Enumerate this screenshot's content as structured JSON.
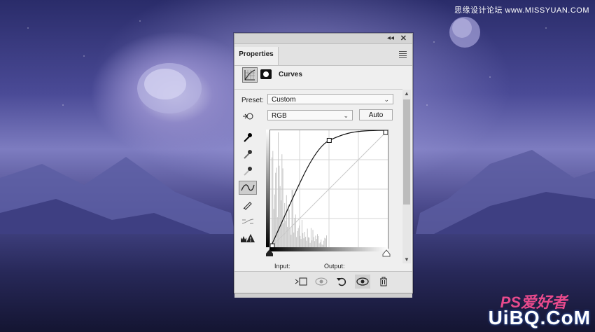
{
  "watermarks": {
    "top": "思缘设计论坛 www.MISSYUAN.COM",
    "ps_mark": "PS爱好者",
    "logo": "UiBQ.CoM"
  },
  "panel": {
    "tab_label": "Properties",
    "adjustment_label": "Curves",
    "preset_label": "Preset:",
    "preset_value": "Custom",
    "channel_value": "RGB",
    "auto_label": "Auto",
    "input_label": "Input:",
    "output_label": "Output:",
    "icons": {
      "collapse": "double-chevron-icon",
      "close": "close-icon",
      "menu": "panel-menu-icon",
      "adjustment": "curves-adjustment-icon",
      "mask": "layer-mask-icon",
      "on_image": "on-image-adjust-icon",
      "sample_black": "eyedropper-black-icon",
      "sample_gray": "eyedropper-gray-icon",
      "sample_white": "eyedropper-white-icon",
      "edit_points": "curve-points-icon",
      "pencil": "pencil-draw-icon",
      "smooth": "smooth-curve-icon",
      "clipping": "clipping-warning-icon",
      "clip_layer": "clip-to-layer-icon",
      "view_previous": "view-previous-icon",
      "reset": "reset-icon",
      "visibility": "eye-icon",
      "delete": "trash-icon"
    }
  },
  "chart_data": {
    "type": "line",
    "xlim": [
      0,
      255
    ],
    "ylim": [
      0,
      255
    ],
    "curve_points": [
      {
        "x": 0,
        "y": 0
      },
      {
        "x": 128,
        "y": 233
      },
      {
        "x": 255,
        "y": 255
      }
    ],
    "diagonal": true,
    "grid": "4x4"
  }
}
